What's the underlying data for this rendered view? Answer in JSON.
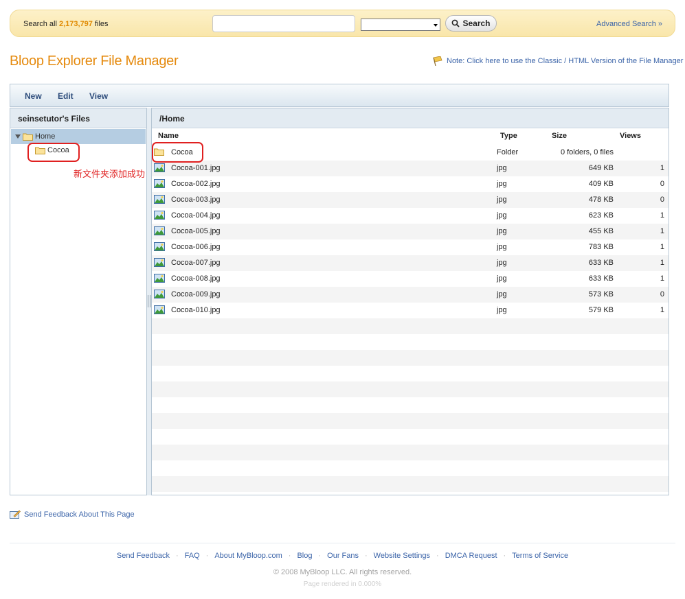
{
  "search": {
    "prefix": "Search all",
    "count": "2,173,797",
    "suffix": "files",
    "query_value": "",
    "category_value": "",
    "button_label": "Search",
    "advanced_label": "Advanced Search »"
  },
  "header": {
    "title": "Bloop Explorer File Manager",
    "classic_note": "Note: Click here to use the Classic / HTML Version of the File Manager"
  },
  "toolbar": {
    "menus": [
      "New",
      "Edit",
      "View"
    ]
  },
  "tree": {
    "title": "seinsetutor's Files",
    "root_label": "Home",
    "child_label": "Cocoa"
  },
  "annotation": "新文件夹添加成功",
  "files": {
    "path": "/Home",
    "columns": {
      "name": "Name",
      "type": "Type",
      "size": "Size",
      "views": "Views"
    },
    "rows": [
      {
        "name": "Cocoa",
        "type": "Folder",
        "size": "0 folders, 0 files",
        "views": "",
        "icon": "folder-icon"
      },
      {
        "name": "Cocoa-001.jpg",
        "type": "jpg",
        "size": "649 KB",
        "views": "1",
        "icon": "image-icon"
      },
      {
        "name": "Cocoa-002.jpg",
        "type": "jpg",
        "size": "409 KB",
        "views": "0",
        "icon": "image-icon"
      },
      {
        "name": "Cocoa-003.jpg",
        "type": "jpg",
        "size": "478 KB",
        "views": "0",
        "icon": "image-icon"
      },
      {
        "name": "Cocoa-004.jpg",
        "type": "jpg",
        "size": "623 KB",
        "views": "1",
        "icon": "image-icon"
      },
      {
        "name": "Cocoa-005.jpg",
        "type": "jpg",
        "size": "455 KB",
        "views": "1",
        "icon": "image-icon"
      },
      {
        "name": "Cocoa-006.jpg",
        "type": "jpg",
        "size": "783 KB",
        "views": "1",
        "icon": "image-icon"
      },
      {
        "name": "Cocoa-007.jpg",
        "type": "jpg",
        "size": "633 KB",
        "views": "1",
        "icon": "image-icon"
      },
      {
        "name": "Cocoa-008.jpg",
        "type": "jpg",
        "size": "633 KB",
        "views": "1",
        "icon": "image-icon"
      },
      {
        "name": "Cocoa-009.jpg",
        "type": "jpg",
        "size": "573 KB",
        "views": "0",
        "icon": "image-icon"
      },
      {
        "name": "Cocoa-010.jpg",
        "type": "jpg",
        "size": "579 KB",
        "views": "1",
        "icon": "image-icon"
      }
    ]
  },
  "footer": {
    "feedback_label": "Send Feedback About This Page",
    "links": [
      "Send Feedback",
      "FAQ",
      "About MyBloop.com",
      "Blog",
      "Our Fans",
      "Website Settings",
      "DMCA Request",
      "Terms of Service"
    ],
    "copyright": "© 2008 MyBloop LLC. All rights reserved.",
    "render_time": "Page rendered in 0.000%"
  },
  "colors": {
    "accent_orange": "#e58a0e",
    "link_blue": "#3a63a8",
    "annotation_red": "#e02020",
    "selection_blue": "#b5cde2"
  }
}
